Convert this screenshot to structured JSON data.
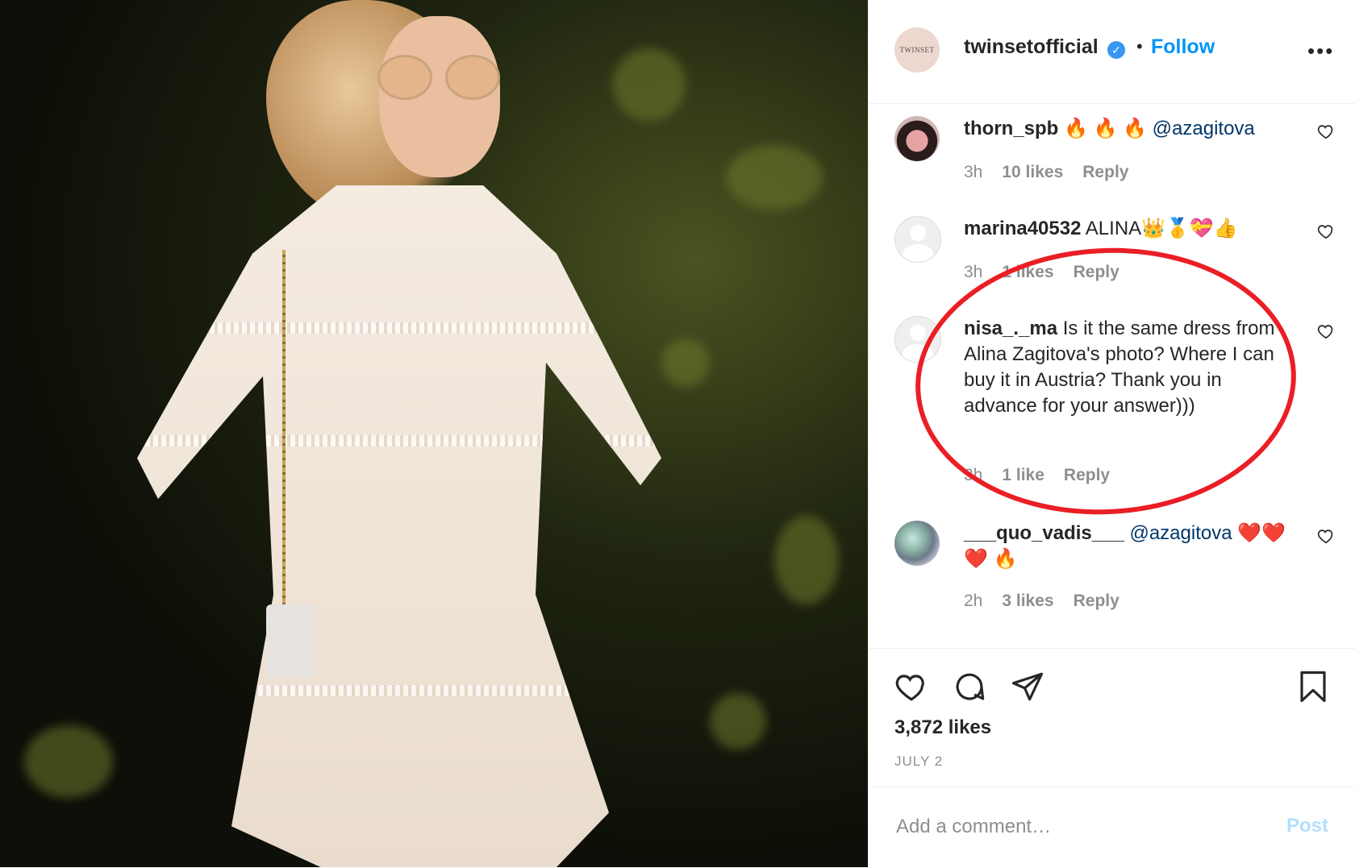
{
  "post": {
    "author": "twinsetofficial",
    "brand_avatar_text": "TWINSET",
    "separator": "•",
    "follow_label": "Follow",
    "more_label": "•••",
    "likes": "3,872 likes",
    "date": "JULY 2"
  },
  "comments": [
    {
      "user": "thorn_spb",
      "text": " 🔥 🔥 🔥 ",
      "mention": "@azagitova",
      "time": "3h",
      "likes": "10 likes",
      "reply": "Reply"
    },
    {
      "user": "marina40532",
      "text": " ALINA👑🥇💝👍",
      "mention": "",
      "time": "3h",
      "likes": "1 likes",
      "reply": "Reply"
    },
    {
      "user": "nisa_._ma",
      "text": " Is it the same dress from Alina Zagitova's photo? Where I can buy it in Austria? Thank you in advance for your answer)))",
      "mention": "",
      "time": "3h",
      "likes": "1 like",
      "reply": "Reply"
    },
    {
      "user": "___quo_vadis___",
      "text": " ",
      "mention": "@azagitova",
      "text2": " ❤️❤️ ❤️ 🔥",
      "time": "2h",
      "likes": "3 likes",
      "reply": "Reply"
    }
  ],
  "composer": {
    "placeholder": "Add a comment…",
    "post_label": "Post"
  },
  "colors": {
    "accent": "#0095f6",
    "highlight_ring": "#ea1f25",
    "meta_text": "#8e8e8e"
  },
  "icons": [
    "verified-badge-icon",
    "more-options-icon",
    "heart-icon",
    "comment-icon",
    "share-icon",
    "bookmark-icon"
  ]
}
